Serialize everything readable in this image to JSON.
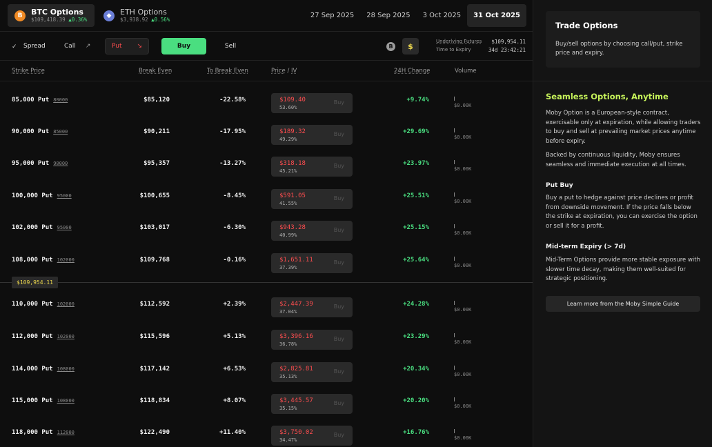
{
  "assets": [
    {
      "name": "BTC Options",
      "icon": "bitcoin-icon",
      "glyph": "B",
      "price": "$109,418.39",
      "change": "0.36%",
      "active": true
    },
    {
      "name": "ETH Options",
      "icon": "ethereum-icon",
      "glyph": "◆",
      "price": "$3,938.92",
      "change": "0.56%",
      "active": false
    }
  ],
  "dates": [
    {
      "label": "27 Sep 2025",
      "active": false
    },
    {
      "label": "28 Sep 2025",
      "active": false
    },
    {
      "label": "3 Oct 2025",
      "active": false
    },
    {
      "label": "31 Oct 2025",
      "active": true
    }
  ],
  "toolbar": {
    "spread": "Spread",
    "call": "Call",
    "put": "Put",
    "buy": "Buy",
    "sell": "Sell",
    "underlying_label": "Underlying Futures",
    "underlying_value": "$109,954.11",
    "expiry_label": "Time to Expiry",
    "expiry_value": "34d 23:42:21"
  },
  "columns": {
    "strike": "Strike Price",
    "break_even": "Break Even",
    "to_break_even": "To Break Even",
    "price": "Price",
    "slash": "/",
    "iv": "IV",
    "change": "24H Change",
    "volume": "Volume"
  },
  "row_buy_label": "Buy",
  "current_price": "$109,954.11",
  "rows": [
    {
      "strike": "85,000 Put",
      "ref": "80000",
      "break_even": "$85,120",
      "to_break_even": "-22.58%",
      "price": "$109.40",
      "iv": "53.60%",
      "change": "+9.74%",
      "volume": "$0.00K"
    },
    {
      "strike": "90,000 Put",
      "ref": "85000",
      "break_even": "$90,211",
      "to_break_even": "-17.95%",
      "price": "$189.32",
      "iv": "49.29%",
      "change": "+29.69%",
      "volume": "$0.00K"
    },
    {
      "strike": "95,000 Put",
      "ref": "90000",
      "break_even": "$95,357",
      "to_break_even": "-13.27%",
      "price": "$318.18",
      "iv": "45.21%",
      "change": "+23.97%",
      "volume": "$0.00K"
    },
    {
      "strike": "100,000 Put",
      "ref": "95000",
      "break_even": "$100,655",
      "to_break_even": "-8.45%",
      "price": "$591.05",
      "iv": "41.55%",
      "change": "+25.51%",
      "volume": "$0.00K"
    },
    {
      "strike": "102,000 Put",
      "ref": "95000",
      "break_even": "$103,017",
      "to_break_even": "-6.30%",
      "price": "$943.28",
      "iv": "40.99%",
      "change": "+25.15%",
      "volume": "$0.00K"
    },
    {
      "strike": "108,000 Put",
      "ref": "102000",
      "break_even": "$109,768",
      "to_break_even": "-0.16%",
      "price": "$1,651.11",
      "iv": "37.39%",
      "change": "+25.64%",
      "volume": "$0.00K"
    },
    {
      "strike": "110,000 Put",
      "ref": "102000",
      "break_even": "$112,592",
      "to_break_even": "+2.39%",
      "price": "$2,447.39",
      "iv": "37.04%",
      "change": "+24.28%",
      "volume": "$0.00K"
    },
    {
      "strike": "112,000 Put",
      "ref": "102000",
      "break_even": "$115,596",
      "to_break_even": "+5.13%",
      "price": "$3,396.16",
      "iv": "36.78%",
      "change": "+23.29%",
      "volume": "$0.00K"
    },
    {
      "strike": "114,000 Put",
      "ref": "108000",
      "break_even": "$117,142",
      "to_break_even": "+6.53%",
      "price": "$2,825.81",
      "iv": "35.13%",
      "change": "+20.34%",
      "volume": "$0.00K"
    },
    {
      "strike": "115,000 Put",
      "ref": "108000",
      "break_even": "$118,834",
      "to_break_even": "+8.07%",
      "price": "$3,445.57",
      "iv": "35.15%",
      "change": "+20.20%",
      "volume": "$0.00K"
    },
    {
      "strike": "118,000 Put",
      "ref": "112000",
      "break_even": "$122,490",
      "to_break_even": "+11.40%",
      "price": "$3,750.02",
      "iv": "34.47%",
      "change": "+16.76%",
      "volume": "$0.00K"
    }
  ],
  "panel": {
    "card_title": "Trade Options",
    "card_text": "Buy/sell options by choosing call/put, strike price and expiry.",
    "heading": "Seamless Options, Anytime",
    "p1": "Moby Option is a European-style contract, exercisable only at expiration, while allowing traders to buy and sell at prevailing market prices anytime before expiry.",
    "p2": "Backed by continuous liquidity, Moby ensures seamless and immediate execution at all times.",
    "h2": "Put Buy",
    "p3": "Buy a put to hedge against price declines or profit from downside movement. If the price falls below the strike at expiration, you can exercise the option or sell it for a profit.",
    "h3": "Mid-term Expiry (> 7d)",
    "p4": "Mid-Term Options provide more stable exposure with slower time decay, making them well-suited for strategic positioning.",
    "learn": "Learn more from the Moby Simple Guide"
  }
}
